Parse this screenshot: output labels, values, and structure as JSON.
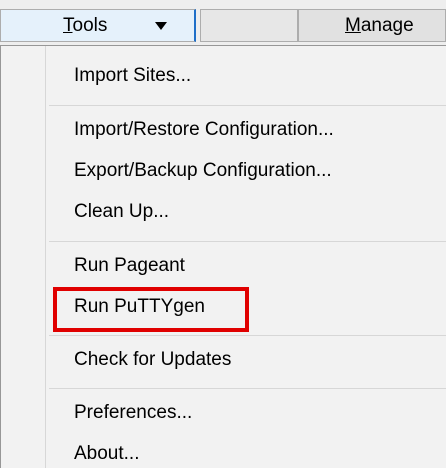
{
  "toolbar": {
    "tools_label_mnemonic": "T",
    "tools_label_rest": "ools",
    "manage_label_mnemonic": "M",
    "manage_label_rest": "anage"
  },
  "menu": {
    "items": [
      {
        "label": "Import Sites..."
      },
      {
        "label": "Import/Restore Configuration..."
      },
      {
        "label": "Export/Backup Configuration..."
      },
      {
        "label": "Clean Up..."
      },
      {
        "label": "Run Pageant"
      },
      {
        "label": "Run PuTTYgen"
      },
      {
        "label": "Check for Updates"
      },
      {
        "label": "Preferences..."
      },
      {
        "label": "About..."
      }
    ]
  },
  "colors": {
    "highlight_border": "#e00000",
    "menu_background": "#f2f2f2",
    "tools_button_focus": "#1f6fc8"
  }
}
